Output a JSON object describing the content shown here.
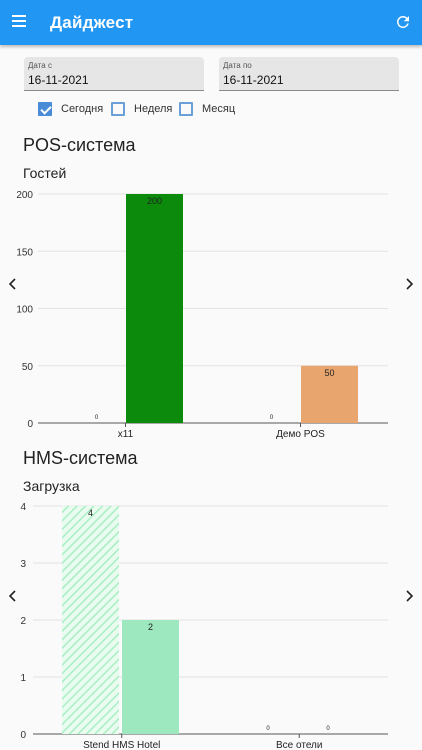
{
  "appbar": {
    "title": "Дайджест",
    "accent": "#2196f3",
    "menu_icon": "hamburger-menu-icon",
    "refresh_icon": "refresh-icon"
  },
  "filters": {
    "date_from_label": "Дата с",
    "date_from_value": "16-11-2021",
    "date_to_label": "Дата по",
    "date_to_value": "16-11-2021",
    "periods": [
      {
        "label": "Сегодня",
        "checked": true
      },
      {
        "label": "Неделя",
        "checked": false
      },
      {
        "label": "Месяц",
        "checked": false
      }
    ]
  },
  "pos": {
    "title": "POS-система",
    "metric": "Гостей"
  },
  "hms": {
    "title": "HMS-система",
    "metric": "Загрузка"
  },
  "chart_data": [
    {
      "type": "bar",
      "title": "Гостей",
      "categories": [
        "x11",
        "Демо POS"
      ],
      "series": [
        {
          "values": [
            0,
            0
          ],
          "colors": [
            "#1a7a1a",
            "#c07a40"
          ]
        },
        {
          "values": [
            200,
            50
          ],
          "colors": [
            "#0b8a0b",
            "#e8a56e"
          ]
        }
      ],
      "yticks": [
        0,
        50,
        100,
        150,
        200
      ],
      "ylim": [
        0,
        200
      ],
      "grid": true,
      "data_labels": true
    },
    {
      "type": "bar",
      "title": "Загрузка",
      "categories": [
        "Stend HMS Hotel",
        "Все отели"
      ],
      "series": [
        {
          "values": [
            4,
            0
          ],
          "colors": [
            "#a8efc4",
            "#a8efc4"
          ],
          "pattern": "hatched"
        },
        {
          "values": [
            2,
            0
          ],
          "colors": [
            "#9de8be",
            "#9de8be"
          ]
        }
      ],
      "yticks": [
        0,
        1,
        2,
        3,
        4
      ],
      "ylim": [
        0,
        4
      ],
      "grid": true,
      "data_labels": true
    }
  ]
}
